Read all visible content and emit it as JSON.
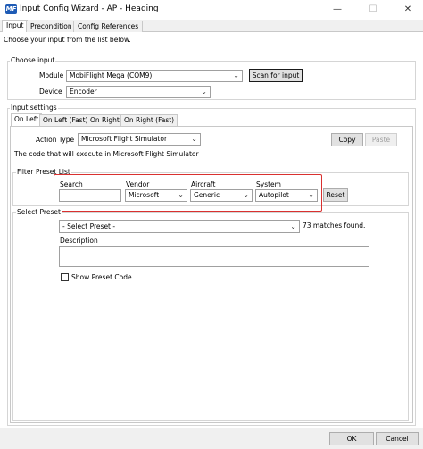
{
  "window": {
    "title": "Input Config Wizard - AP - Heading",
    "app_icon_text": "MF",
    "minimize": "—",
    "maximize": "☐",
    "close": "✕"
  },
  "tabs": [
    {
      "label": "Input",
      "active": true
    },
    {
      "label": "Precondition",
      "active": false
    },
    {
      "label": "Config References",
      "active": false
    }
  ],
  "hint": "Choose your input from the list below.",
  "choose_input": {
    "title": "Choose input",
    "module_label": "Module",
    "module_value": "MobiFlight Mega (COM9)",
    "scan_button": "Scan for input",
    "device_label": "Device",
    "device_value": "Encoder"
  },
  "input_settings": {
    "title": "Input settings",
    "subtabs": [
      {
        "label": "On Left",
        "active": true
      },
      {
        "label": "On Left (Fast)",
        "active": false
      },
      {
        "label": "On Right",
        "active": false
      },
      {
        "label": "On Right (Fast)",
        "active": false
      }
    ],
    "action_type_label": "Action Type",
    "action_type_value": "Microsoft Flight Simulator",
    "copy_button": "Copy",
    "paste_button": "Paste",
    "code_text": "The code that will execute in Microsoft Flight Simulator"
  },
  "filter": {
    "title": "Filter Preset List",
    "search_label": "Search",
    "search_value": "",
    "vendor_label": "Vendor",
    "vendor_value": "Microsoft",
    "aircraft_label": "Aircraft",
    "aircraft_value": "Generic",
    "system_label": "System",
    "system_value": "Autopilot",
    "reset_button": "Reset"
  },
  "select_preset": {
    "title": "Select Preset",
    "preset_value": "- Select Preset -",
    "matches": "73 matches found.",
    "description_label": "Description",
    "description_value": "",
    "show_code_label": "Show Preset Code",
    "show_code_checked": false
  },
  "footer": {
    "ok_button": "OK",
    "cancel_button": "Cancel"
  },
  "colors": {
    "highlight": "#d9302f",
    "icon_blue": "#1e5bb5"
  }
}
